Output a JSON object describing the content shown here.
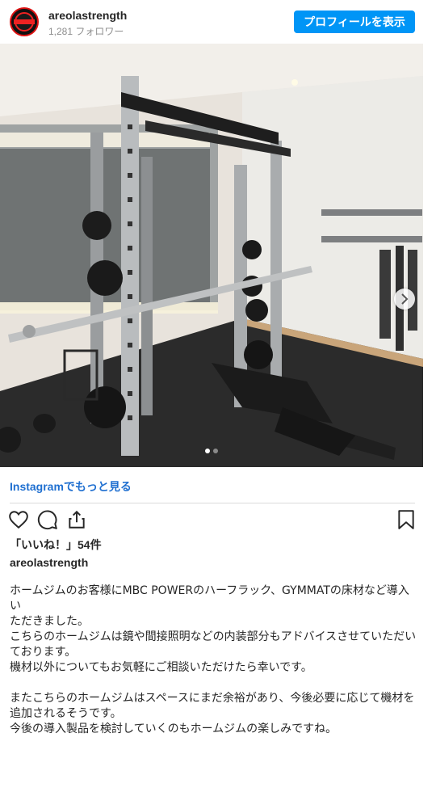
{
  "header": {
    "username": "areolastrength",
    "followers": "1,281 フォロワー",
    "profile_button": "プロフィールを表示",
    "avatar_icon": "brand-logo-icon"
  },
  "post": {
    "image_alt_icon": "home-gym-photo",
    "carousel": {
      "current": 1,
      "total": 2
    },
    "next_icon": "chevron-right-icon",
    "more_link": "Instagramでもっと見る",
    "likes": "「いいね！」54件",
    "caption_user": "areolastrength",
    "caption": "ホームジムのお客様にMBC POWERのハーフラック、GYMMATの床材など導入い\nただきました。\nこちらのホームジムは鏡や間接照明などの内装部分もアドバイスさせていただい\nております。\n機材以外についてもお気軽にご相談いただけたら幸いです。\n\nまたこちらのホームジムはスペースにまだ余裕があり、今後必要に応じて機材を\n追加されるそうです。\n今後の導入製品を検討していくのもホームジムの楽しみですね。"
  },
  "actions": {
    "like_icon": "heart-icon",
    "comment_icon": "comment-icon",
    "share_icon": "share-icon",
    "save_icon": "bookmark-icon"
  },
  "colors": {
    "accent": "#0095f6",
    "link": "#1f6fd0",
    "text": "#262626",
    "muted": "#8e8e8e"
  }
}
